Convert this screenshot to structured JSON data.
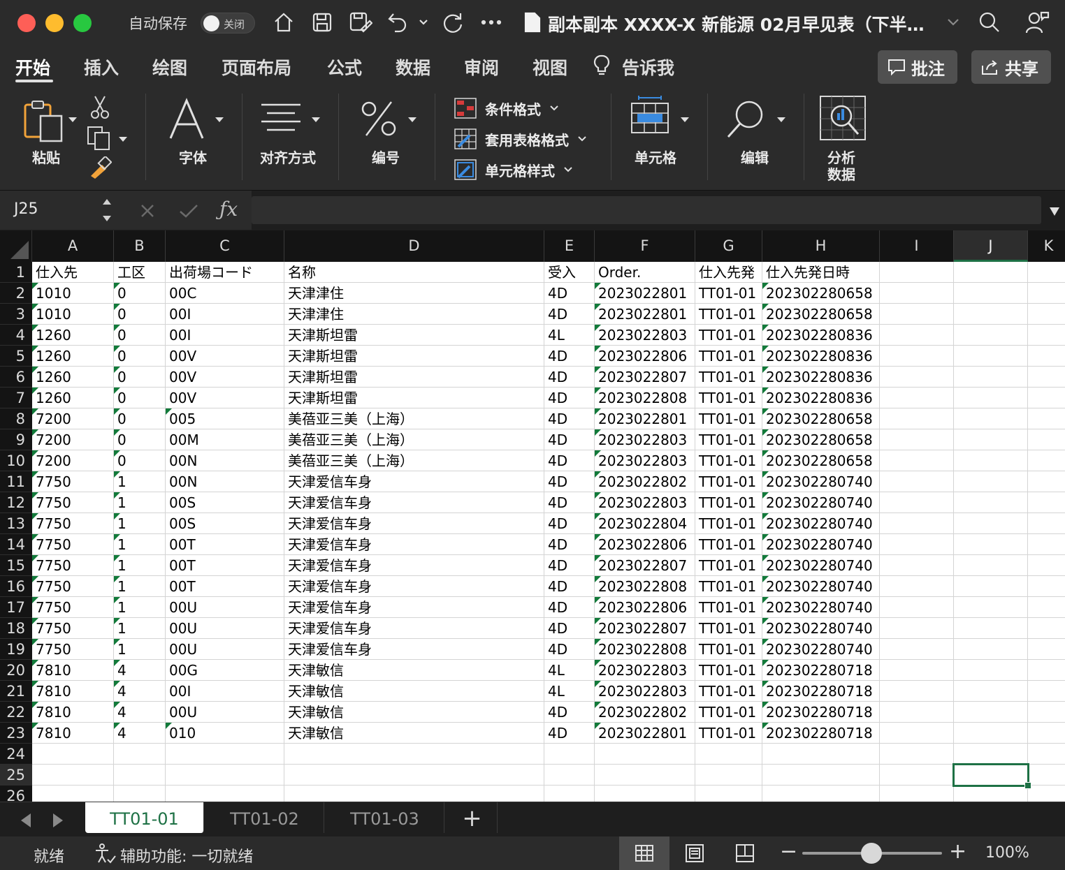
{
  "titlebar": {
    "autosave_label": "自动保存",
    "autosave_state": "关闭",
    "document_title": "副本副本 XXXX-X 新能源 02月早见表（下半…",
    "icons": [
      "home-icon",
      "save-icon",
      "save-as-icon",
      "undo-icon",
      "redo-icon",
      "more-icon",
      "search-icon",
      "share-person-icon"
    ]
  },
  "ribbon_tabs": {
    "items": [
      "开始",
      "插入",
      "绘图",
      "页面布局",
      "公式",
      "数据",
      "审阅",
      "视图"
    ],
    "active": "开始",
    "tell_me": "告诉我",
    "comments_label": "批注",
    "share_label": "共享"
  },
  "ribbon": {
    "paste": "粘贴",
    "font": "字体",
    "alignment": "对齐方式",
    "number": "编号",
    "conditional_format": "条件格式",
    "format_as_table": "套用表格格式",
    "cell_styles": "单元格样式",
    "cells": "单元格",
    "editing": "编辑",
    "analyze_line1": "分析",
    "analyze_line2": "数据"
  },
  "formula_bar": {
    "name_box": "J25",
    "formula": ""
  },
  "grid": {
    "columns": [
      "A",
      "B",
      "C",
      "D",
      "E",
      "F",
      "G",
      "H",
      "I",
      "J",
      "K"
    ],
    "selected_column": "J",
    "selected_row": "25",
    "row_numbers": [
      "1",
      "2",
      "3",
      "4",
      "5",
      "6",
      "7",
      "8",
      "9",
      "10",
      "11",
      "12",
      "13",
      "14",
      "15",
      "16",
      "17",
      "18",
      "19",
      "20",
      "21",
      "22",
      "23",
      "24",
      "25",
      "26"
    ],
    "header_row": [
      "仕入先",
      "工区",
      "出荷場コード",
      "名称",
      "受入",
      "Order.",
      "仕入先発",
      "仕入先発日時"
    ],
    "rows": [
      [
        "1010",
        "0",
        "00C",
        "天津津住",
        "4D",
        "2023022801",
        "TT01-01",
        "202302280658"
      ],
      [
        "1010",
        "0",
        "00I",
        "天津津住",
        "4D",
        "2023022801",
        "TT01-01",
        "202302280658"
      ],
      [
        "1260",
        "0",
        "00I",
        "天津斯坦雷",
        "4L",
        "2023022803",
        "TT01-01",
        "202302280836"
      ],
      [
        "1260",
        "0",
        "00V",
        "天津斯坦雷",
        "4D",
        "2023022806",
        "TT01-01",
        "202302280836"
      ],
      [
        "1260",
        "0",
        "00V",
        "天津斯坦雷",
        "4D",
        "2023022807",
        "TT01-01",
        "202302280836"
      ],
      [
        "1260",
        "0",
        "00V",
        "天津斯坦雷",
        "4D",
        "2023022808",
        "TT01-01",
        "202302280836"
      ],
      [
        "7200",
        "0",
        "005",
        "美蓓亚三美（上海）",
        "4D",
        "2023022801",
        "TT01-01",
        "202302280658"
      ],
      [
        "7200",
        "0",
        "00M",
        "美蓓亚三美（上海）",
        "4D",
        "2023022803",
        "TT01-01",
        "202302280658"
      ],
      [
        "7200",
        "0",
        "00N",
        "美蓓亚三美（上海）",
        "4D",
        "2023022803",
        "TT01-01",
        "202302280658"
      ],
      [
        "7750",
        "1",
        "00N",
        "天津爱信车身",
        "4D",
        "2023022802",
        "TT01-01",
        "202302280740"
      ],
      [
        "7750",
        "1",
        "00S",
        "天津爱信车身",
        "4D",
        "2023022803",
        "TT01-01",
        "202302280740"
      ],
      [
        "7750",
        "1",
        "00S",
        "天津爱信车身",
        "4D",
        "2023022804",
        "TT01-01",
        "202302280740"
      ],
      [
        "7750",
        "1",
        "00T",
        "天津爱信车身",
        "4D",
        "2023022806",
        "TT01-01",
        "202302280740"
      ],
      [
        "7750",
        "1",
        "00T",
        "天津爱信车身",
        "4D",
        "2023022807",
        "TT01-01",
        "202302280740"
      ],
      [
        "7750",
        "1",
        "00T",
        "天津爱信车身",
        "4D",
        "2023022808",
        "TT01-01",
        "202302280740"
      ],
      [
        "7750",
        "1",
        "00U",
        "天津爱信车身",
        "4D",
        "2023022806",
        "TT01-01",
        "202302280740"
      ],
      [
        "7750",
        "1",
        "00U",
        "天津爱信车身",
        "4D",
        "2023022807",
        "TT01-01",
        "202302280740"
      ],
      [
        "7750",
        "1",
        "00U",
        "天津爱信车身",
        "4D",
        "2023022808",
        "TT01-01",
        "202302280740"
      ],
      [
        "7810",
        "4",
        "00G",
        "天津敏信",
        "4L",
        "2023022803",
        "TT01-01",
        "202302280718"
      ],
      [
        "7810",
        "4",
        "00I",
        "天津敏信",
        "4L",
        "2023022803",
        "TT01-01",
        "202302280718"
      ],
      [
        "7810",
        "4",
        "00U",
        "天津敏信",
        "4D",
        "2023022802",
        "TT01-01",
        "202302280718"
      ],
      [
        "7810",
        "4",
        "010",
        "天津敏信",
        "4D",
        "2023022801",
        "TT01-01",
        "202302280718"
      ]
    ],
    "text_marker_color": "#127a3a",
    "selection_color": "#1e7145"
  },
  "sheets": {
    "tabs": [
      "TT01-01",
      "TT01-02",
      "TT01-03"
    ],
    "active": "TT01-01",
    "add": "+"
  },
  "statusbar": {
    "ready": "就绪",
    "accessibility": "辅助功能: 一切就绪",
    "zoom_level": "100%",
    "zoom_minus": "−",
    "zoom_plus": "+"
  }
}
